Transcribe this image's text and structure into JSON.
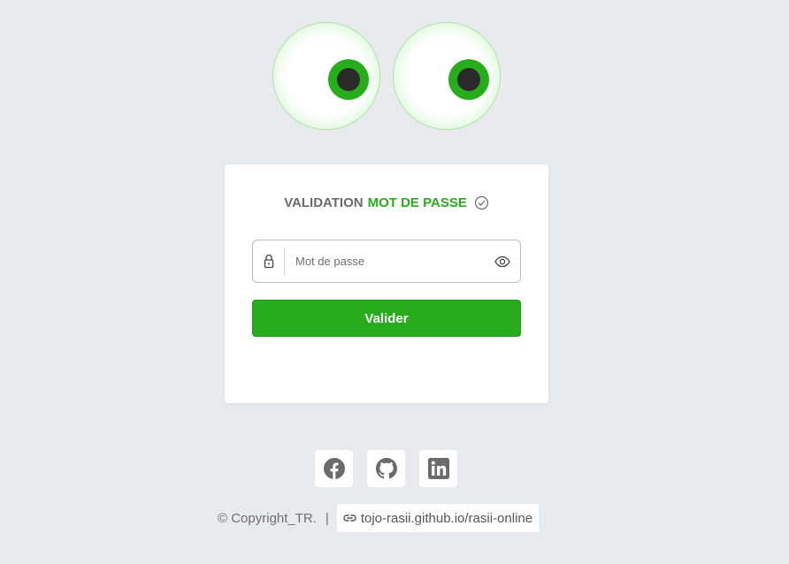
{
  "form": {
    "title_part1": "VALIDATION",
    "title_part2": "MOT DE PASSE",
    "password_placeholder": "Mot de passe",
    "password_value": "",
    "submit_label": "Valider"
  },
  "social": {
    "icons": [
      "facebook-icon",
      "github-icon",
      "linkedin-icon"
    ]
  },
  "footer": {
    "copyright": "© Copyright_TR.",
    "separator": "|",
    "link_text": "tojo-rasii.github.io/rasii-online"
  },
  "colors": {
    "accent": "#27ad1b",
    "background": "#e8eaed",
    "text_gray": "#6b6b6b"
  }
}
